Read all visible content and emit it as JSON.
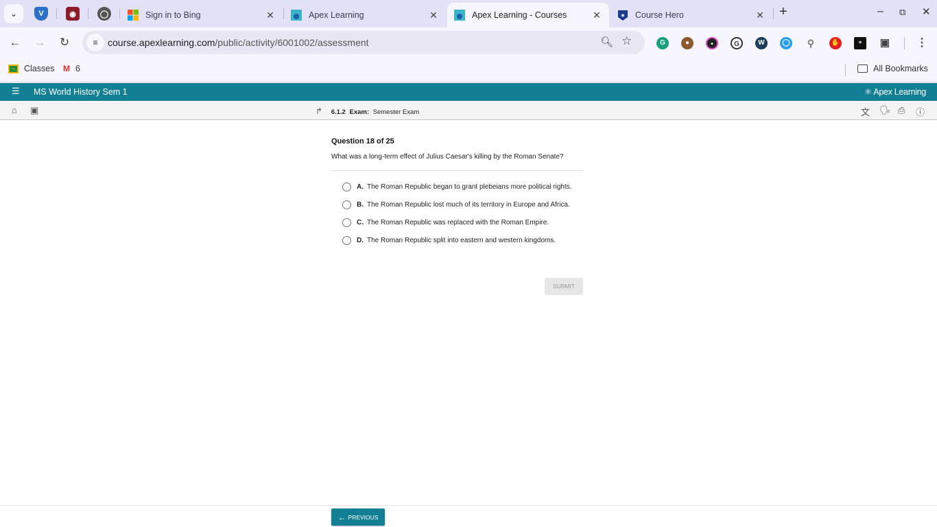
{
  "browser": {
    "tabs": [
      {
        "title": "Sign in to Bing",
        "icon": "microsoft-icon",
        "active": false
      },
      {
        "title": "Apex Learning",
        "icon": "apex-icon",
        "active": false
      },
      {
        "title": "Apex Learning - Courses",
        "icon": "apex-icon",
        "active": true
      },
      {
        "title": "Course Hero",
        "icon": "course-hero-icon",
        "active": false
      }
    ],
    "pinned_tabs": [
      "vpn-shield-icon",
      "cat-mask-icon",
      "chrome-icon"
    ],
    "url_host": "course.apexlearning.com",
    "url_path": "/public/activity/6001002/assessment",
    "extensions": [
      "grammarly-icon",
      "cookie-icon",
      "robot-icon",
      "g-icon",
      "w-icon",
      "blue-circle-icon",
      "bulb-icon",
      "adblock-icon",
      "share-icon",
      "puzzle-icon"
    ],
    "bookmarks": [
      {
        "label": "Classes",
        "icon": "google-classroom-icon"
      },
      {
        "label": "6",
        "icon": "gmail-icon"
      }
    ],
    "all_bookmarks_label": "All Bookmarks"
  },
  "app": {
    "course_title": "MS World History Sem 1",
    "logo_text": "Apex Learning",
    "breadcrumb": {
      "number": "6.1.2",
      "type": "Exam:",
      "name": "Semester Exam"
    },
    "brand_color": "#137f94"
  },
  "question": {
    "counter": "Question 18 of 25",
    "text": "What was a long-term effect of Julius Caesar's killing by the Roman Senate?",
    "choices": [
      {
        "letter": "A.",
        "text": "The Roman Republic began to grant plebeians more political rights."
      },
      {
        "letter": "B.",
        "text": "The Roman Republic lost much of its territory in Europe and Africa."
      },
      {
        "letter": "C.",
        "text": "The Roman Republic was replaced with the Roman Empire."
      },
      {
        "letter": "D.",
        "text": "The Roman Republic split into eastern and western kingdoms."
      }
    ],
    "submit_label": "SUBMIT"
  },
  "footer": {
    "previous_label": "PREVIOUS"
  }
}
